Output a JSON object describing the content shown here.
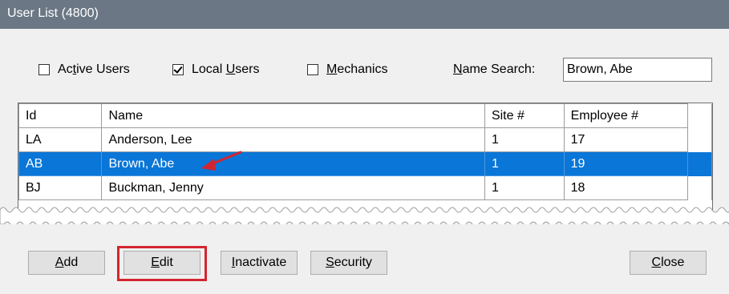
{
  "window": {
    "title": "User List (4800)"
  },
  "filters": {
    "active_users": {
      "label": "Active Users",
      "checked": false
    },
    "local_users": {
      "label": "Local Users",
      "checked": true
    },
    "mechanics": {
      "label": "Mechanics",
      "checked": false
    }
  },
  "name_search": {
    "label": "Name Search:",
    "value": "Brown, Abe"
  },
  "table": {
    "columns": [
      "Id",
      "Name",
      "Site #",
      "Employee #"
    ],
    "rows": [
      {
        "id": "LA",
        "name": "Anderson, Lee",
        "site": "1",
        "employee": "17",
        "selected": false
      },
      {
        "id": "AB",
        "name": "Brown, Abe",
        "site": "1",
        "employee": "19",
        "selected": true
      },
      {
        "id": "BJ",
        "name": "Buckman, Jenny",
        "site": "1",
        "employee": "18",
        "selected": false
      }
    ]
  },
  "buttons": {
    "add": "Add",
    "edit": "Edit",
    "inactivate": "Inactivate",
    "security": "Security",
    "close": "Close"
  },
  "colors": {
    "title_bar": "#6b7784",
    "selection": "#0a76d8",
    "callout": "#d4252f"
  }
}
